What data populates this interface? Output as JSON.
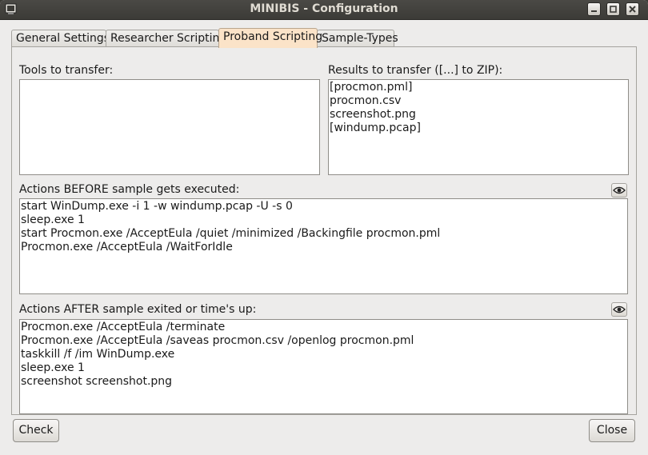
{
  "window": {
    "title": "MINIBIS - Configuration"
  },
  "titlebar_icons": {
    "app": "terminal-icon",
    "minimize": "minimize-icon",
    "maximize": "maximize-icon",
    "close": "close-icon"
  },
  "tabs": [
    {
      "label": "General Settings"
    },
    {
      "label": "Researcher Scripting"
    },
    {
      "label": "Proband Scripting",
      "active": true
    },
    {
      "label": "Sample-Types"
    }
  ],
  "tools": {
    "label": "Tools to transfer:",
    "items": []
  },
  "results": {
    "label": "Results to transfer ([...] to ZIP):",
    "items": [
      "[procmon.pml]",
      "procmon.csv",
      "screenshot.png",
      "[windump.pcap]"
    ]
  },
  "before": {
    "label": "Actions BEFORE sample gets executed:",
    "icon": "eye-icon",
    "lines": [
      "start WinDump.exe -i 1 -w windump.pcap -U -s 0",
      "sleep.exe 1",
      "start Procmon.exe /AcceptEula /quiet /minimized /Backingfile procmon.pml",
      "Procmon.exe /AcceptEula /WaitForIdle"
    ]
  },
  "after": {
    "label": "Actions AFTER sample exited or time's up:",
    "icon": "eye-icon",
    "lines": [
      "Procmon.exe /AcceptEula /terminate",
      "Procmon.exe /AcceptEula /saveas procmon.csv /openlog procmon.pml",
      "taskkill /f /im WinDump.exe",
      "sleep.exe 1",
      "screenshot screenshot.png"
    ]
  },
  "buttons": {
    "check": "Check",
    "close": "Close"
  }
}
